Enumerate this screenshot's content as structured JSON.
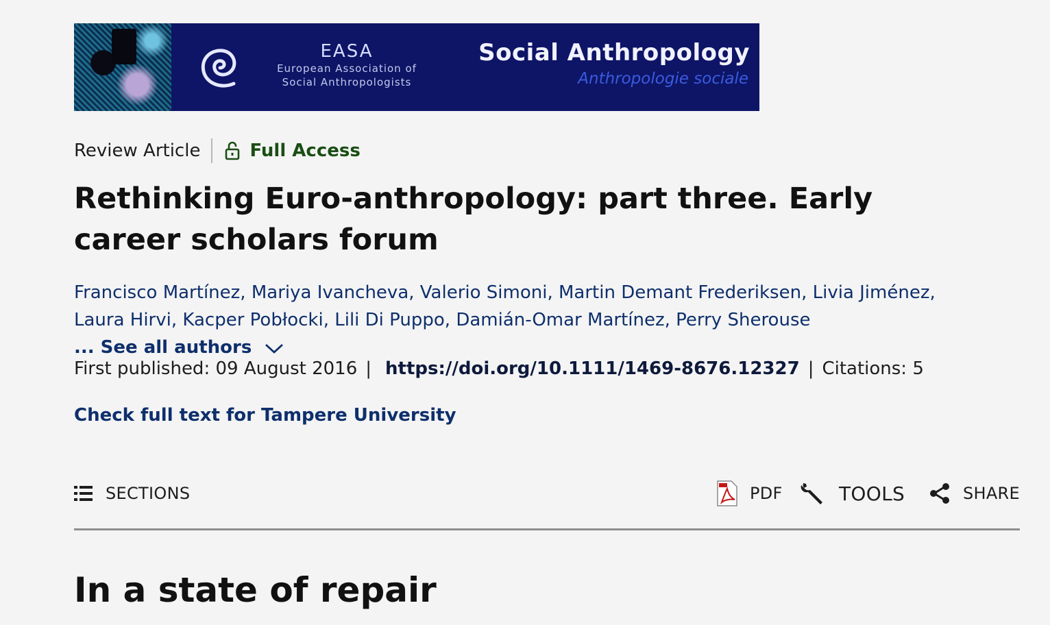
{
  "banner": {
    "easa_title": "EASA",
    "easa_line1": "European Association of",
    "easa_line2": "Social Anthropologists",
    "journal_title": "Social Anthropology",
    "journal_subtitle": "Anthropologie sociale"
  },
  "article": {
    "type": "Review Article",
    "access_label": "Full Access",
    "title": "Rethinking Euro-anthropology: part three. Early career scholars forum",
    "authors": [
      "Francisco Martínez",
      "Mariya Ivancheva",
      "Valerio Simoni",
      "Martin Demant Frederiksen",
      "Livia Jiménez",
      "Laura Hirvi",
      "Kacper Pobłocki",
      "Lili Di Puppo",
      "Damián-Omar Martínez",
      "Perry Sherouse"
    ],
    "see_all_label": "... See all authors",
    "first_published_label": "First published:",
    "first_published_date": "09 August 2016",
    "doi": "https://doi.org/10.1111/1469-8676.12327",
    "citations_label": "Citations:",
    "citations_count": "5",
    "check_full_text": "Check full text for Tampere University"
  },
  "toolbar": {
    "sections_label": "SECTIONS",
    "pdf_label": "PDF",
    "tools_label": "TOOLS",
    "share_label": "SHARE"
  },
  "content": {
    "section_heading": "In a state of repair"
  },
  "colors": {
    "page_bg": "#f4f4f4",
    "banner_bg": "#0e1566",
    "link": "#0e2f6c",
    "access_green": "#1a4e14"
  }
}
